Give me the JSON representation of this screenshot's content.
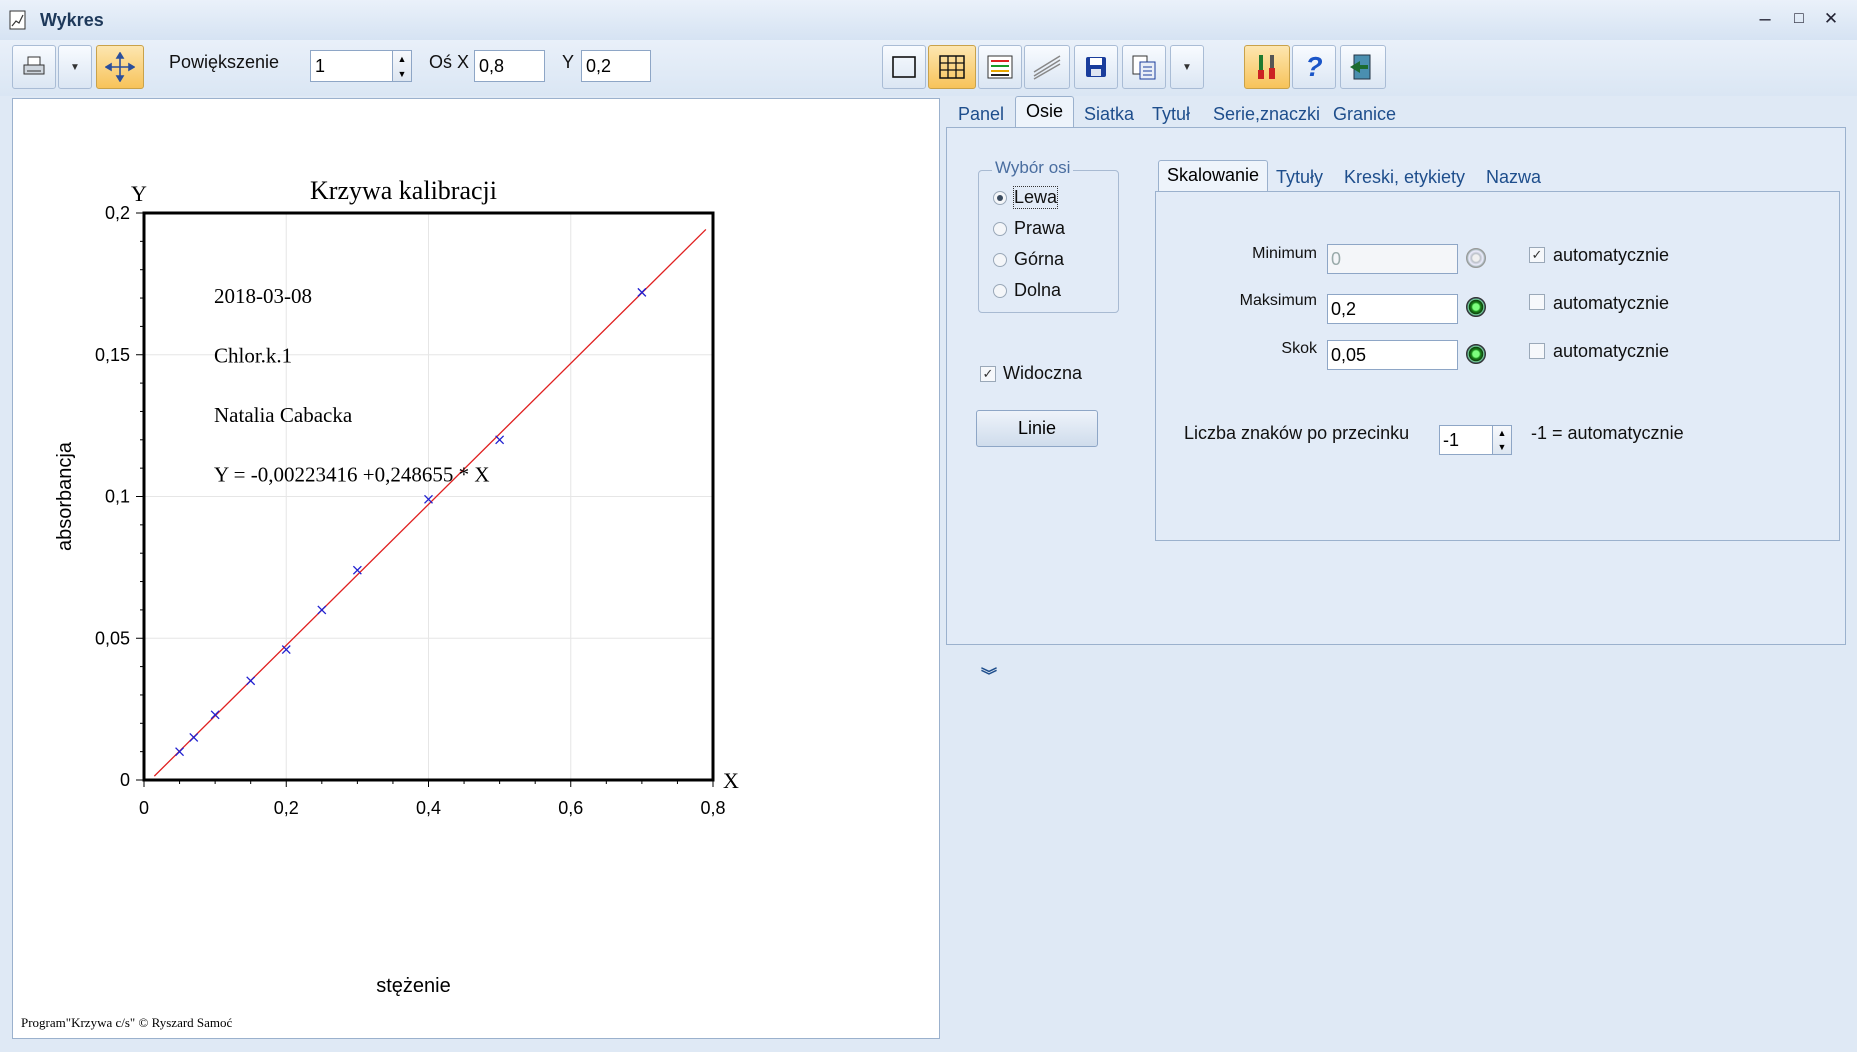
{
  "window": {
    "title": "Wykres",
    "buttons": [
      "–",
      "□",
      "✕"
    ]
  },
  "toolbar": {
    "zoom_label": "Powiększenie",
    "zoom_value": "1",
    "axis_x_label": "Oś X",
    "axis_x_value": "0,8",
    "axis_y_label": "Y",
    "axis_y_value": "0,2"
  },
  "chart_data": {
    "type": "scatter",
    "title": "Krzywa kalibracji",
    "xlabel": "stężenie",
    "ylabel": "absorbancja",
    "x_axis_letter": "X",
    "y_axis_letter": "Y",
    "xlim": [
      0,
      0.8
    ],
    "ylim": [
      0,
      0.2
    ],
    "xticks": [
      "0",
      "0,2",
      "0,4",
      "0,6",
      "0,8"
    ],
    "yticks": [
      "0",
      "0,05",
      "0,1",
      "0,15",
      "0,2"
    ],
    "grid": true,
    "series": [
      {
        "marker": "x",
        "color": "#2020d0",
        "points": [
          [
            0.05,
            0.01
          ],
          [
            0.07,
            0.015
          ],
          [
            0.1,
            0.023
          ],
          [
            0.15,
            0.035
          ],
          [
            0.2,
            0.046
          ],
          [
            0.25,
            0.06
          ],
          [
            0.3,
            0.074
          ],
          [
            0.4,
            0.099
          ],
          [
            0.5,
            0.12
          ],
          [
            0.7,
            0.172
          ]
        ]
      }
    ],
    "fit_line": {
      "color": "#e02020",
      "intercept": -0.00223416,
      "slope": 0.248655,
      "x_range": [
        0.0145,
        0.79
      ]
    },
    "annotations": [
      "2018-03-08",
      "Chlor.k.1",
      "Natalia Cabacka",
      "Y = -0,00223416 +0,248655 * X"
    ],
    "footer": "Program\"Krzywa c/s\" © Ryszard Samoć"
  },
  "tabs": [
    "Panel",
    "Osie",
    "Siatka",
    "Tytuł",
    "Serie,znaczki",
    "Granice"
  ],
  "active_tab": "Osie",
  "axis_selector": {
    "title": "Wybór osi",
    "options": [
      "Lewa",
      "Prawa",
      "Górna",
      "Dolna"
    ],
    "selected": "Lewa"
  },
  "visible_label": "Widoczna",
  "lines_button": "Linie",
  "subtabs": [
    "Skalowanie",
    "Tytuły",
    "Kreski, etykiety",
    "Nazwa"
  ],
  "scaling": {
    "minimum_label": "Minimum",
    "minimum_value": "0",
    "maximum_label": "Maksimum",
    "maximum_value": "0,2",
    "step_label": "Skok",
    "step_value": "0,05",
    "auto_label": "automatycznie",
    "decimals_label": "Liczba znaków po przecinku",
    "decimals_value": "-1",
    "decimals_hint": "-1 = automatycznie"
  },
  "colors": {
    "accent": "#f7c35a",
    "fit_line": "#e02020",
    "markers": "#2020d0"
  }
}
